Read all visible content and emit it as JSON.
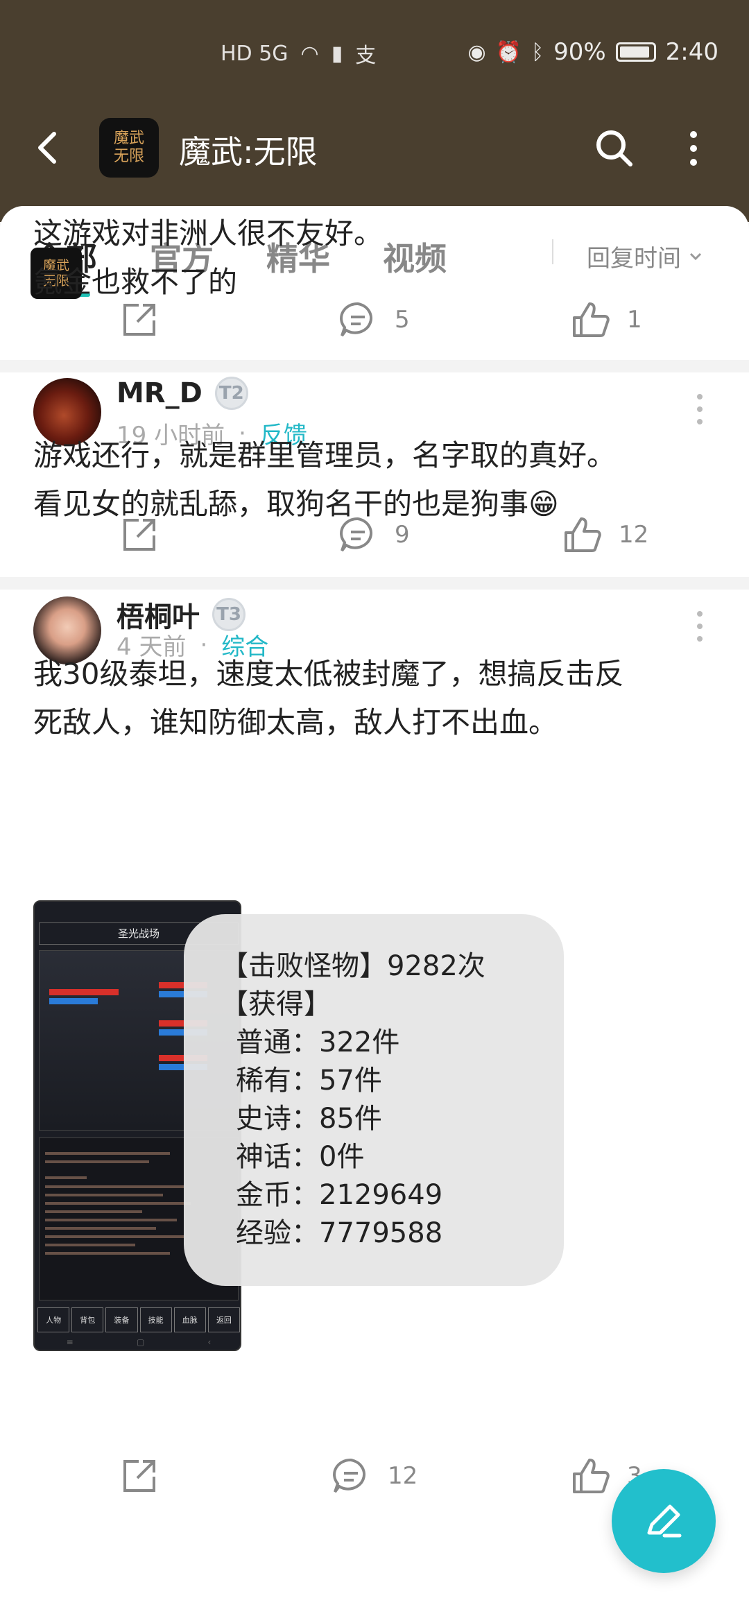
{
  "status_bar": {
    "network": "HD 5G",
    "battery": "90%",
    "time": "2:40"
  },
  "header": {
    "app_name": "魔武:无限",
    "logo_text": "魔武无限"
  },
  "tabs": [
    {
      "label": "全部",
      "active": true
    },
    {
      "label": "官方",
      "active": false
    },
    {
      "label": "精华",
      "active": false
    },
    {
      "label": "视频",
      "active": false
    }
  ],
  "sort_label": "回复时间",
  "posts": [
    {
      "text_lines": [
        "这游戏对非洲人很不友好。",
        "氪金也救不了的"
      ],
      "comments": "5",
      "likes": "1"
    },
    {
      "user": "MR_D",
      "level": "T2",
      "time": "19 小时前",
      "category": "反馈",
      "text_lines": [
        "游戏还行，就是群里管理员，名字取的真好。",
        "看见女的就乱舔，取狗名干的也是狗事😁"
      ],
      "comments": "9",
      "likes": "12"
    },
    {
      "user": "梧桐叶",
      "level": "T3",
      "time": "4 天前",
      "category": "综合",
      "text_lines": [
        "我30级泰坦，速度太低被封魔了，想搞反击反",
        "死敌人，谁知防御太高，敌人打不出血。"
      ],
      "comments": "12",
      "likes": "3"
    }
  ],
  "game_screenshot": {
    "title": "圣光战场",
    "buttons": [
      "人物",
      "背包",
      "装备",
      "技能",
      "血脉",
      "返回"
    ]
  },
  "toast": {
    "lines": [
      "【击败怪物】9282次",
      "【获得】",
      "普通：322件",
      "稀有：57件",
      "史诗：85件",
      "神话：0件",
      "金币：2129649",
      "经验：7779588"
    ]
  },
  "colors": {
    "header_bg": "#4a3f2f",
    "accent": "#22bfcc",
    "category": "#22b8c7"
  }
}
